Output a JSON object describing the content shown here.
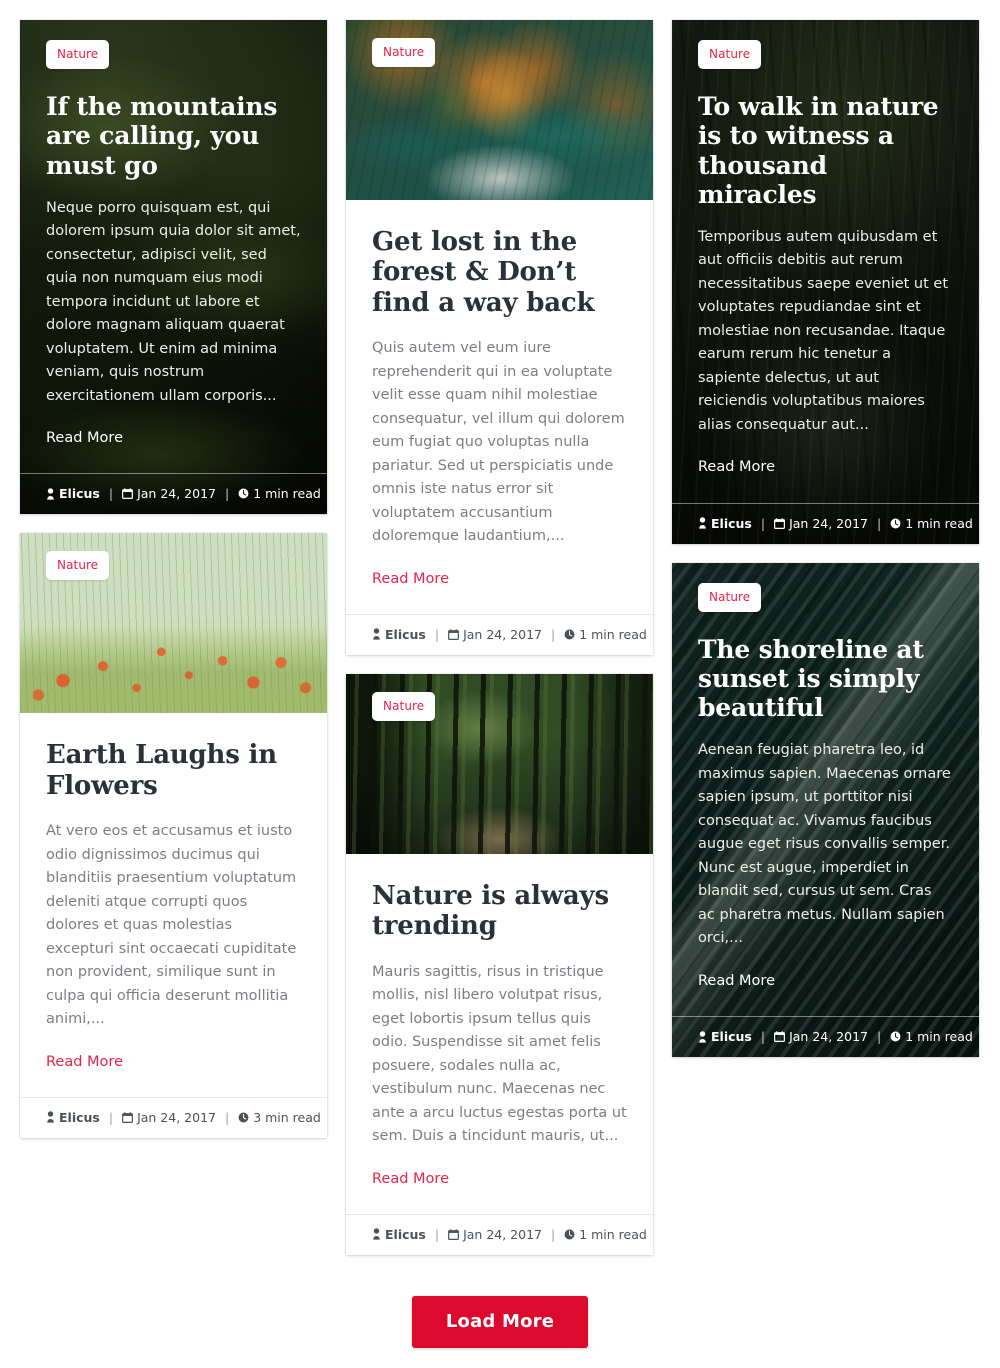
{
  "author": "Elicus",
  "colors": {
    "accent": "#e8234a",
    "button": "#dc0a2d",
    "title_dark": "#2b3138",
    "excerpt": "#7d7d84"
  },
  "icons": {
    "user": "user-icon",
    "calendar": "calendar-icon",
    "clock": "clock-icon"
  },
  "cards": [
    {
      "id": "if-the-mountains-are-calling",
      "style": "dark",
      "art": "art-mountain",
      "badge": "Nature",
      "title": "If the mountains are calling, you must go",
      "excerpt": "Neque porro quisquam est, qui dolorem ipsum quia dolor sit amet, consectetur, adipisci velit, sed quia non numquam eius modi tempora incidunt ut labore et dolore magnam aliquam quaerat voluptatem. Ut enim ad minima veniam, quis nostrum exercitationem ullam corporis...",
      "read_more": "Read More",
      "author": "Elicus",
      "date": "Jan 24, 2017",
      "read_time": "1 min read"
    },
    {
      "id": "earth-laughs-in-flowers",
      "style": "light",
      "art": "art-poppy",
      "badge": "Nature",
      "title": "Earth Laughs in Flowers",
      "excerpt": "At vero eos et accusamus et iusto odio dignissimos ducimus qui blanditiis praesentium voluptatum deleniti atque corrupti quos dolores et quas molestias excepturi sint occaecati cupiditate non provident, similique sunt in culpa qui officia deserunt mollitia animi,...",
      "read_more": "Read More",
      "author": "Elicus",
      "date": "Jan 24, 2017",
      "read_time": "3 min read"
    },
    {
      "id": "get-lost-in-the-forest",
      "style": "light",
      "art": "art-lake",
      "badge": "Nature",
      "title": "Get lost in the forest & Don’t find a way back",
      "excerpt": "Quis autem vel eum iure reprehenderit qui in ea voluptate velit esse quam nihil molestiae consequatur, vel illum qui dolorem eum fugiat quo voluptas nulla pariatur. Sed ut perspiciatis unde omnis iste natus error sit voluptatem accusantium doloremque laudantium,...",
      "read_more": "Read More",
      "author": "Elicus",
      "date": "Jan 24, 2017",
      "read_time": "1 min read"
    },
    {
      "id": "nature-is-always-trending",
      "style": "light",
      "art": "art-path",
      "badge": "Nature",
      "title": "Nature is always trending",
      "excerpt": "Mauris sagittis, risus in tristique mollis, nisl libero volutpat risus, eget lobortis ipsum tellus quis odio. Suspendisse sit amet felis posuere, sodales nulla ac, vestibulum nunc. Maecenas nec ante a arcu luctus egestas porta ut sem. Duis a tincidunt mauris, ut...",
      "read_more": "Read More",
      "author": "Elicus",
      "date": "Jan 24, 2017",
      "read_time": "1 min read"
    },
    {
      "id": "to-walk-in-nature",
      "style": "dark",
      "art": "art-jungle",
      "badge": "Nature",
      "title": "To walk in nature is to witness a thousand miracles",
      "excerpt": "Temporibus autem quibusdam et aut officiis debitis aut rerum necessitatibus saepe eveniet ut et voluptates repudiandae sint et molestiae non recusandae. Itaque earum rerum hic tenetur a sapiente delectus, ut aut reiciendis voluptatibus maiores alias consequatur aut...",
      "read_more": "Read More",
      "author": "Elicus",
      "date": "Jan 24, 2017",
      "read_time": "1 min read"
    },
    {
      "id": "the-shoreline-at-sunset",
      "style": "dark",
      "art": "art-shore",
      "badge": "Nature",
      "title": "The shoreline at sunset is simply beautiful",
      "excerpt": "Aenean feugiat pharetra leo, id maximus sapien. Maecenas ornare sapien ipsum, ut porttitor nisi consequat ac. Vivamus faucibus augue eget risus convallis semper. Nunc est augue, imperdiet in blandit sed, cursus ut sem. Cras ac pharetra metus. Nullam sapien orci,...",
      "read_more": "Read More",
      "author": "Elicus",
      "date": "Jan 24, 2017",
      "read_time": "1 min read"
    }
  ],
  "load_more": {
    "label": "Load More"
  },
  "separator": "|"
}
